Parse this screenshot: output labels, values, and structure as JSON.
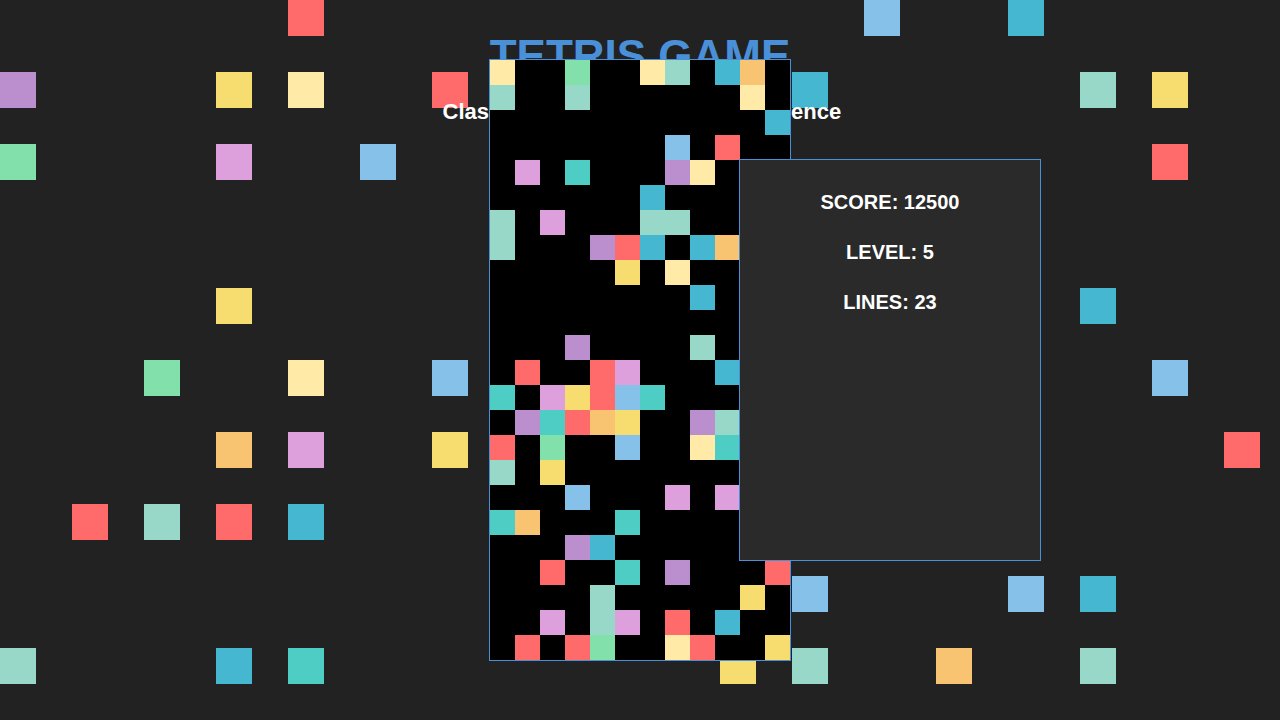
{
  "title": "TETRIS GAME",
  "subtitle_visible": [
    "Clas",
    "ence"
  ],
  "stats": [
    {
      "label": "SCORE: 12500"
    },
    {
      "label": "LEVEL: 5"
    },
    {
      "label": "LINES: 23"
    }
  ],
  "board": {
    "palette": {
      "R": "#ff6b6b",
      "Y": "#f7dc6f",
      "W": "#ffeaa7",
      "M": "#98d8c8",
      "G": "#82e0aa",
      "T": "#4ecdc4",
      "B": "#45b7d1",
      "L": "#85c1e9",
      "P": "#bb8fce",
      "K": "#dda0dd",
      "O": "#f8c471"
    },
    "rows": [
      "W..G..WM.BO.",
      "M..M......W.",
      "...........B",
      ".......L.R..",
      ".K.T...PW...",
      "......B.....",
      "M.K...MM....",
      "M...PRB.BO..",
      ".....Y.W....",
      "........B...",
      "............",
      "...P....M...",
      ".R..RK...B..",
      "T.KYRLT.....",
      ".PTROY..PM..",
      "R.G..L..WT..",
      "M.Y.........",
      "...L...K.K..",
      "TO...T......",
      "...PB.......",
      "..R..T.P...R",
      "....M.....Y.",
      "..K.MK.R.B..",
      ".R.RG..WR..Y"
    ]
  }
}
